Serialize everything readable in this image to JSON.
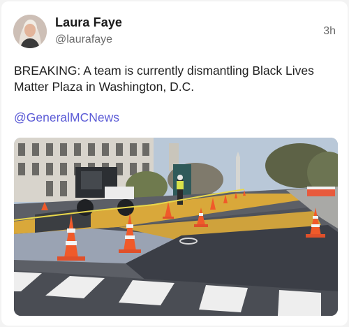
{
  "tweet": {
    "author_name": "Laura Faye",
    "handle": "@laurafaye",
    "timestamp": "3h",
    "text": "BREAKING: A team is currently dismantling Black Lives Matter Plaza in Washington, D.C.",
    "mention": "@GeneralMCNews"
  },
  "media": {
    "type": "video-still",
    "description_icon": "street-scene-image"
  },
  "colors": {
    "link": "#5b5bd6",
    "text": "#1f1f1f",
    "muted": "#6b6b6b"
  }
}
